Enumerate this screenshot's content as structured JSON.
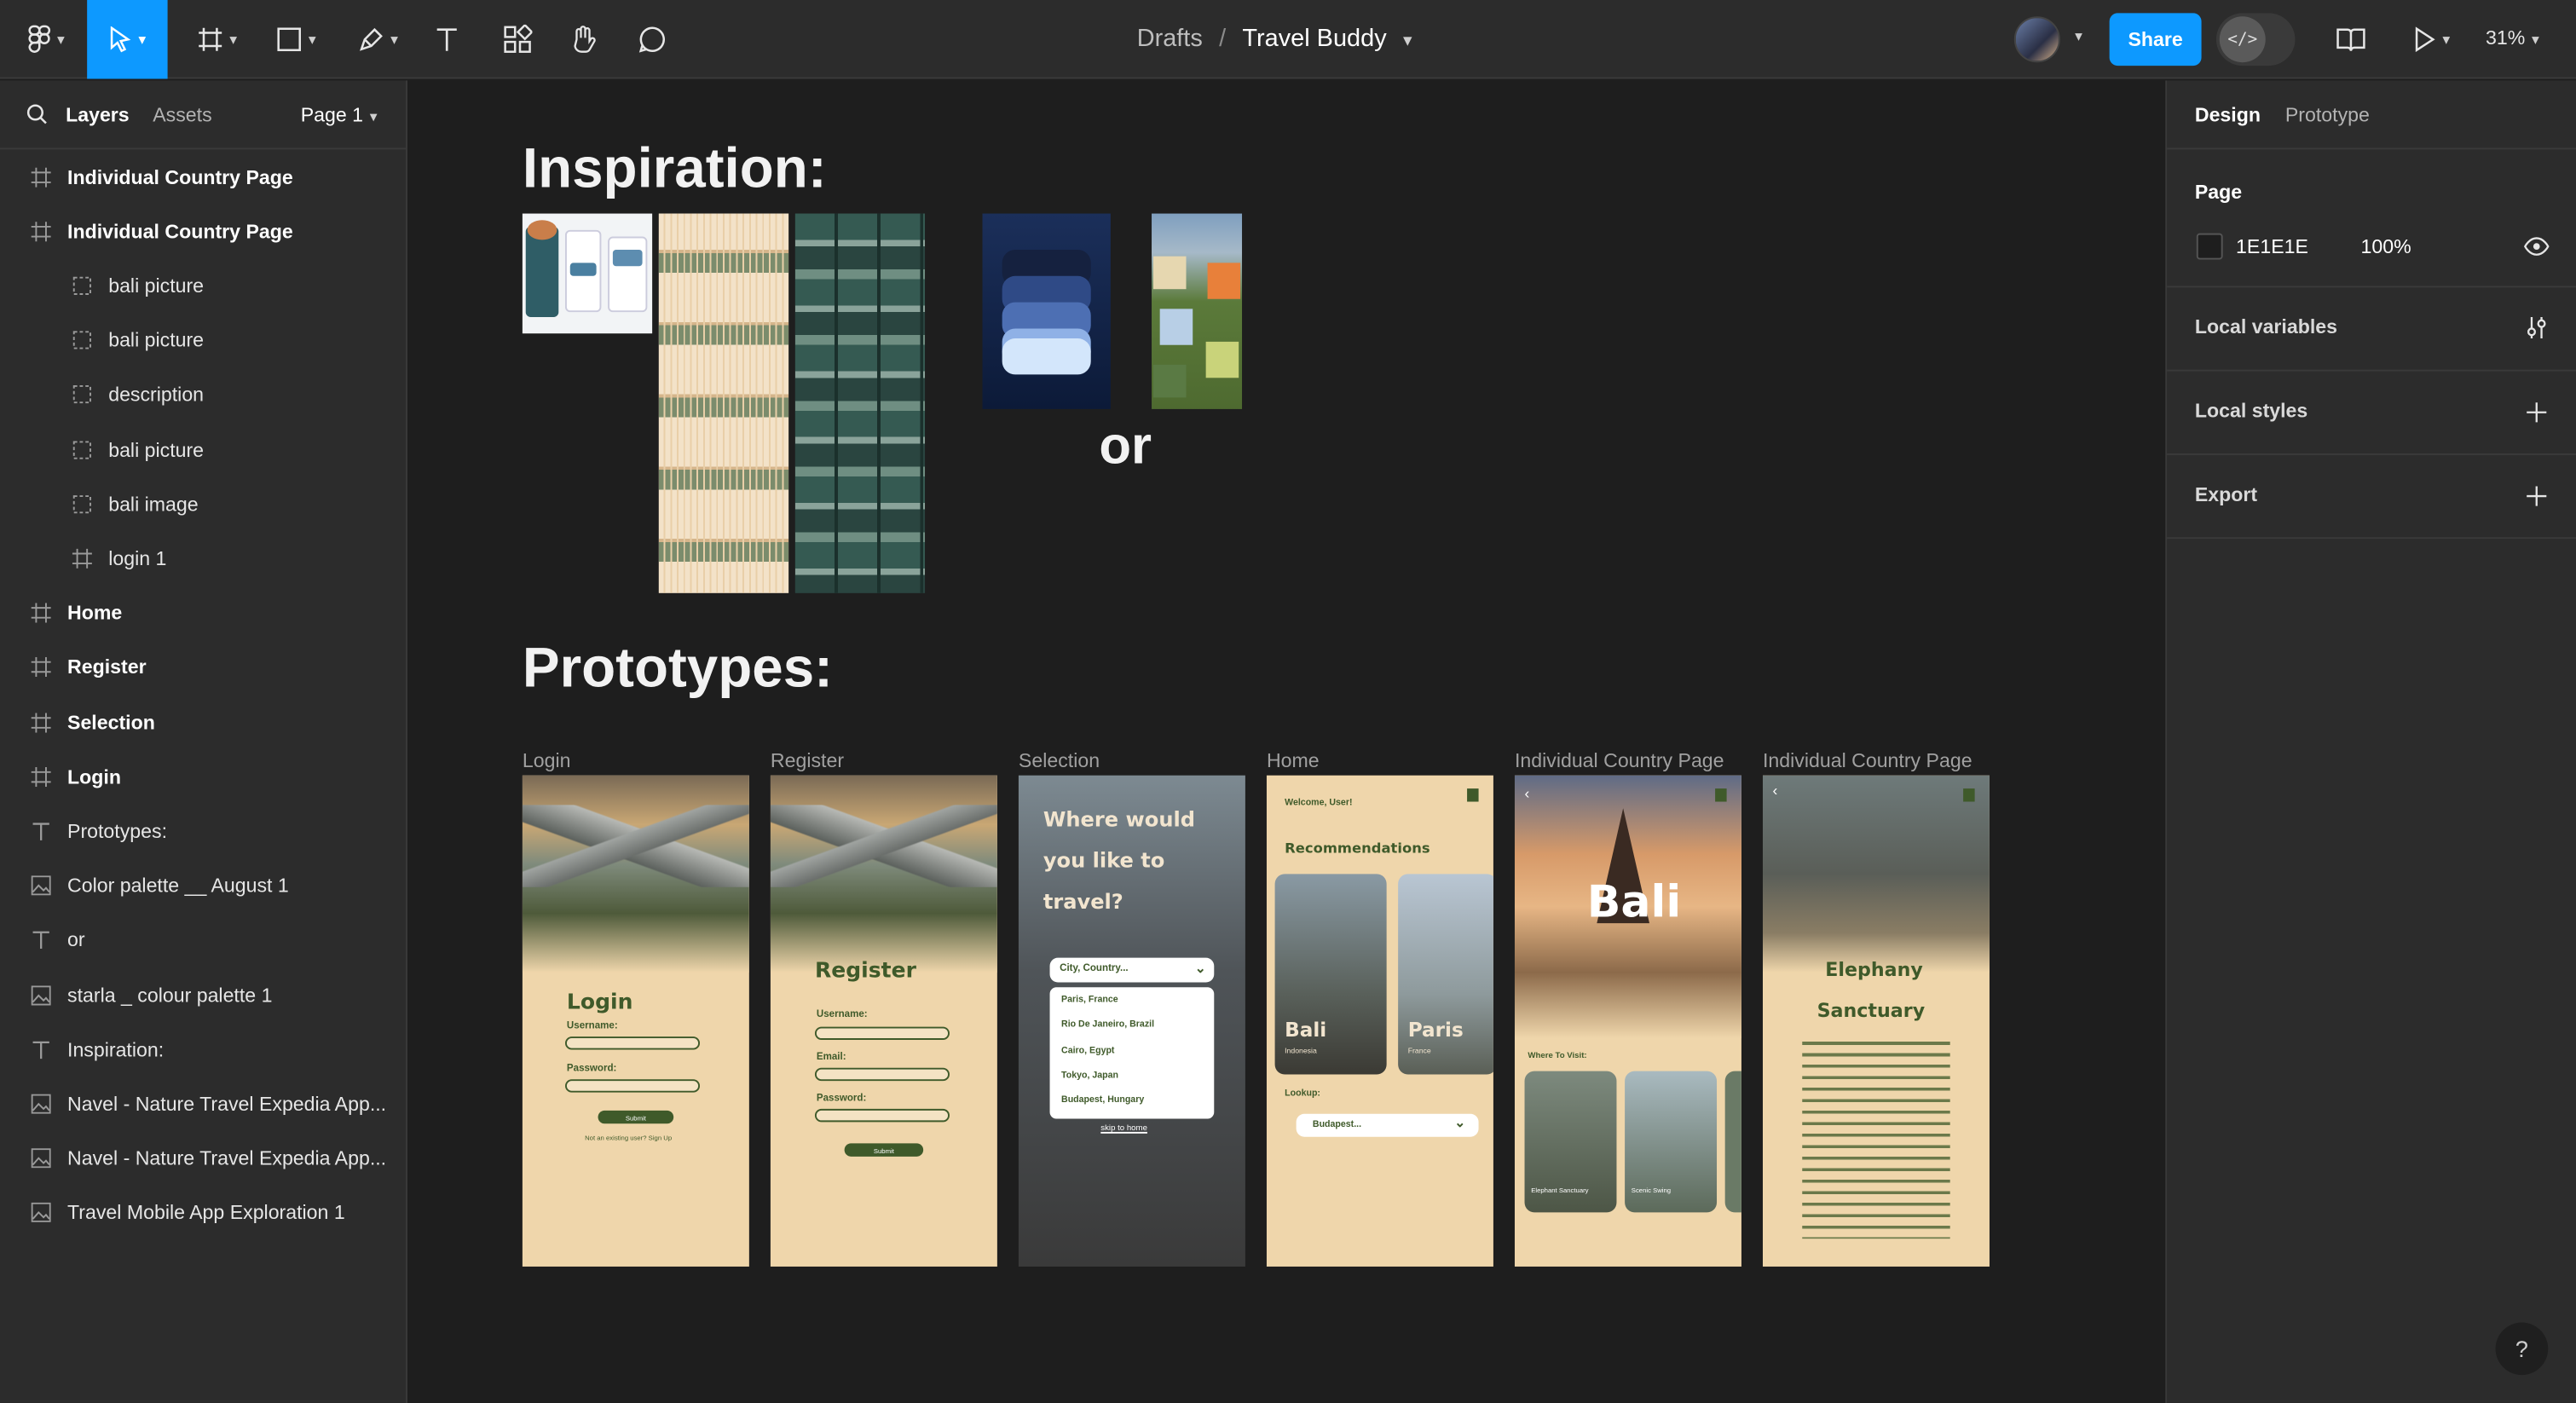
{
  "toolbar": {
    "breadcrumb_folder": "Drafts",
    "breadcrumb_sep": "/",
    "file_name": "Travel Buddy",
    "share_label": "Share",
    "zoom_label": "31%"
  },
  "left_panel": {
    "tab_layers": "Layers",
    "tab_assets": "Assets",
    "page_selector": "Page 1",
    "layers": [
      {
        "label": "Individual Country Page",
        "type": "frame",
        "indent": 0
      },
      {
        "label": "Individual Country Page",
        "type": "frame",
        "indent": 0
      },
      {
        "label": "bali picture",
        "type": "group",
        "indent": 1
      },
      {
        "label": "bali picture",
        "type": "group",
        "indent": 1
      },
      {
        "label": "description",
        "type": "group",
        "indent": 1
      },
      {
        "label": "bali picture",
        "type": "group",
        "indent": 1
      },
      {
        "label": "bali image",
        "type": "group",
        "indent": 1
      },
      {
        "label": "login 1",
        "type": "frame",
        "indent": 1
      },
      {
        "label": "Home",
        "type": "frame",
        "indent": 0
      },
      {
        "label": "Register",
        "type": "frame",
        "indent": 0
      },
      {
        "label": "Selection",
        "type": "frame",
        "indent": 0
      },
      {
        "label": "Login",
        "type": "frame",
        "indent": 0
      },
      {
        "label": "Prototypes:",
        "type": "text",
        "indent": 0
      },
      {
        "label": "Color palette __ August 1",
        "type": "image",
        "indent": 0
      },
      {
        "label": "or",
        "type": "text",
        "indent": 0
      },
      {
        "label": "starla _ colour palette 1",
        "type": "image",
        "indent": 0
      },
      {
        "label": "Inspiration:",
        "type": "text",
        "indent": 0
      },
      {
        "label": "Navel - Nature Travel Expedia App...",
        "type": "image",
        "indent": 0
      },
      {
        "label": "Navel - Nature Travel Expedia App...",
        "type": "image",
        "indent": 0
      },
      {
        "label": "Travel Mobile App Exploration 1",
        "type": "image",
        "indent": 0
      }
    ]
  },
  "right_panel": {
    "tab_design": "Design",
    "tab_prototype": "Prototype",
    "page_section": "Page",
    "bg_hex": "1E1E1E",
    "bg_opacity": "100%",
    "local_variables": "Local variables",
    "local_styles": "Local styles",
    "export": "Export",
    "help": "?"
  },
  "canvas": {
    "inspiration_heading": "Inspiration:",
    "or_text": "or",
    "prototypes_heading": "Prototypes:",
    "frame_labels": [
      "Login",
      "Register",
      "Selection",
      "Home",
      "Individual Country Page",
      "Individual Country Page"
    ],
    "login_frame": {
      "title": "Login",
      "username": "Username:",
      "password": "Password:",
      "submit": "Submit",
      "footer": "Not an existing user? Sign Up"
    },
    "register_frame": {
      "title": "Register",
      "username": "Username:",
      "email": "Email:",
      "password": "Password:",
      "submit": "Submit"
    },
    "selection_frame": {
      "question": "Where would you like to travel?",
      "dropdown": "City, Country...",
      "options": [
        "Paris, France",
        "Rio De Janeiro, Brazil",
        "Cairo, Egypt",
        "Tokyo, Japan",
        "Budapest, Hungary"
      ],
      "skip": "skip to home"
    },
    "home_frame": {
      "welcome": "Welcome, User!",
      "recommendations": "Recommendations",
      "card1": "Bali",
      "card1_sub": "Indonesia",
      "card2": "Paris",
      "card2_sub": "France",
      "lookup": "Lookup:",
      "lookup_value": "Budapest..."
    },
    "bali_frame": {
      "title": "Bali",
      "where": "Where To Visit:",
      "card1": "Elephant Sanctuary",
      "card2": "Scenic Swing"
    },
    "elephant_frame": {
      "title_line1": "Elephany",
      "title_line2": "Sanctuary"
    }
  },
  "colors": {
    "accent": "#0d99ff",
    "panel": "#2c2c2c",
    "canvas": "#1e1e1e",
    "proto_bg": "#efd6ab",
    "proto_green": "#3f5a2a"
  }
}
